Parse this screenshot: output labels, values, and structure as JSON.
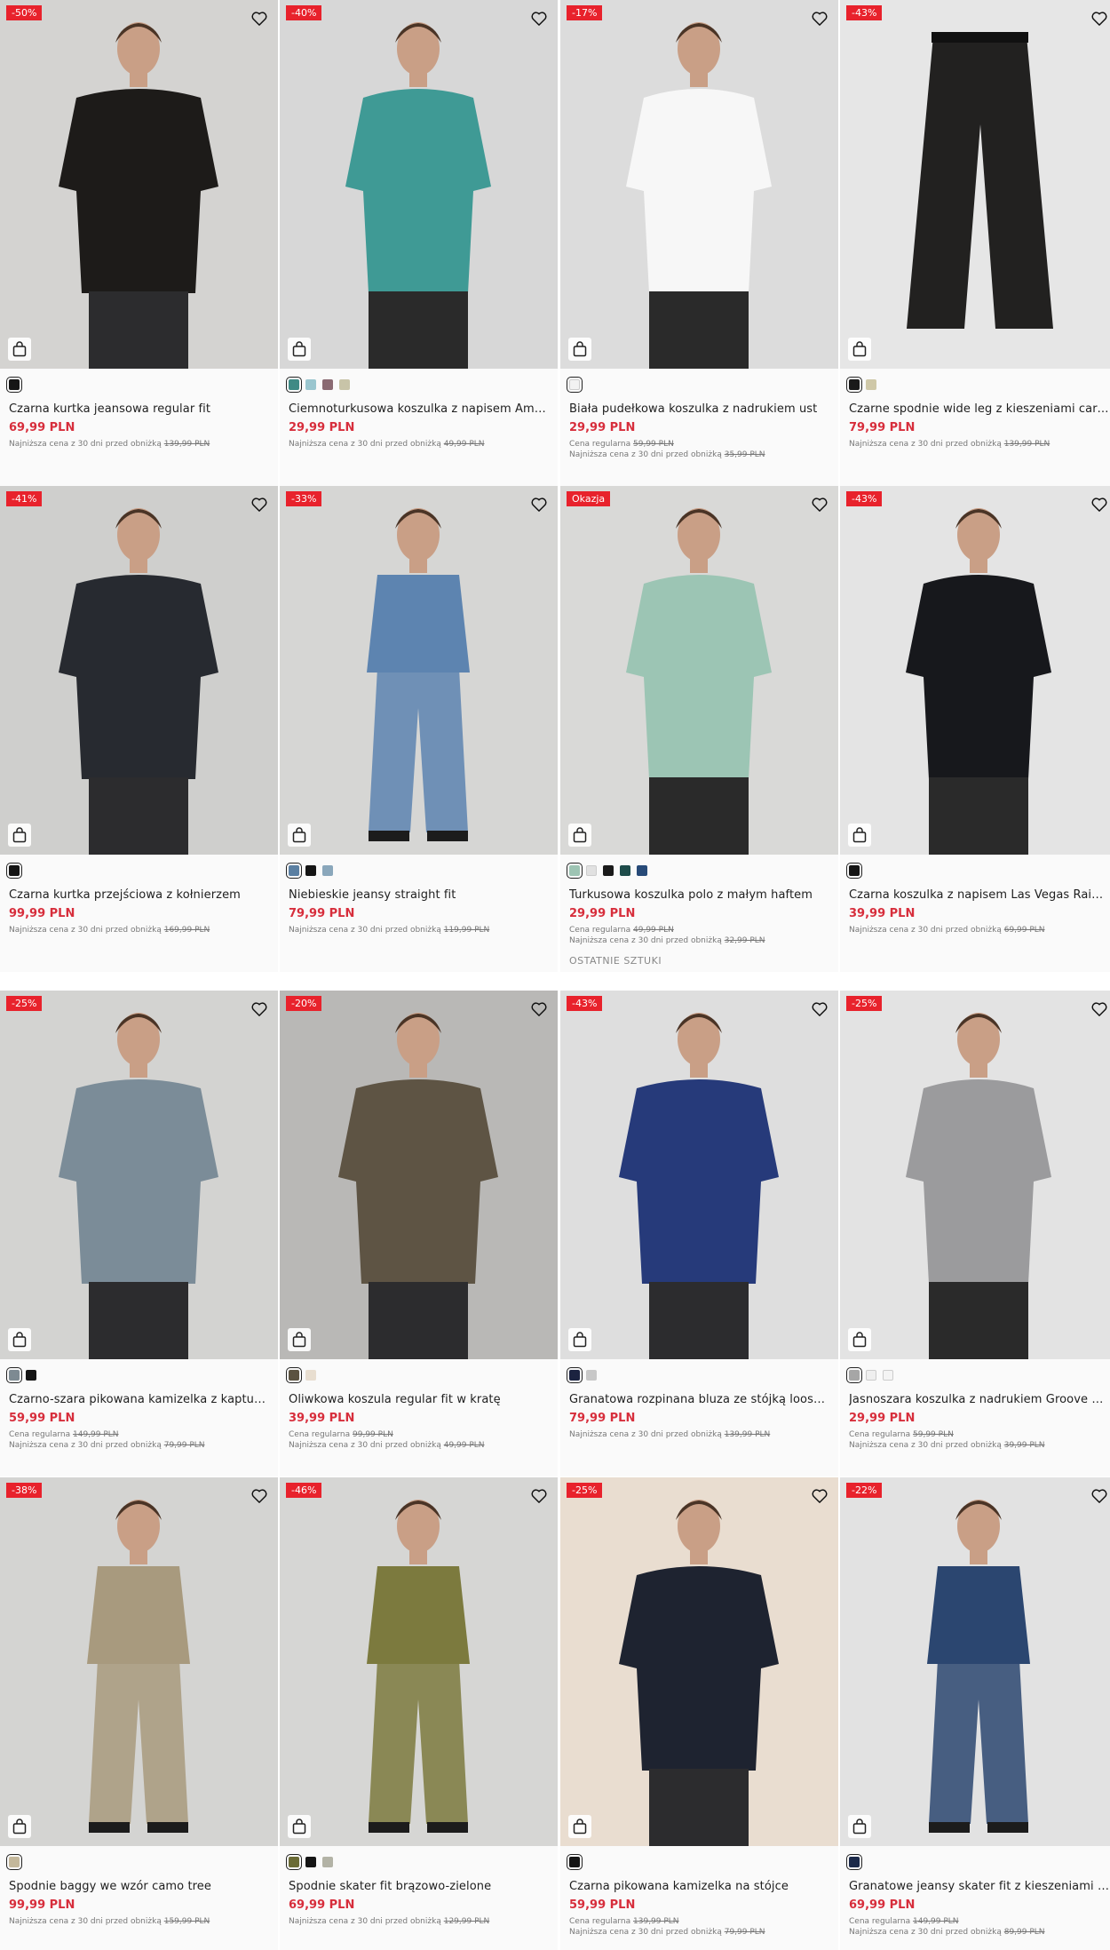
{
  "colors": {
    "discount": "#e8222c",
    "price": "#d72e3c"
  },
  "products": [
    {
      "name": "Czarna kurtka jeansowa regular fit",
      "price": "69,99 PLN",
      "badge": "-50%",
      "swatches": [
        "#151515"
      ],
      "regular_label": "",
      "regular_old": "",
      "lowest_label": "Najniższa cena z 30 dni przed obniżką",
      "lowest_old": "139,99 PLN",
      "extra": "",
      "bg": "#d4d3d1",
      "garment": "#1d1b19",
      "kind": "jacket"
    },
    {
      "name": "Ciemnoturkusowa koszulka z napisem Amalfi Coast",
      "price": "29,99 PLN",
      "badge": "-40%",
      "swatches": [
        "#3f8a85",
        "#9ac6cf",
        "#8a6a72",
        "#c8c4a8"
      ],
      "regular_label": "",
      "regular_old": "",
      "lowest_label": "Najniższa cena z 30 dni przed obniżką",
      "lowest_old": "49,99 PLN",
      "extra": "",
      "bg": "#d7d7d7",
      "garment": "#3f9a95",
      "kind": "tee"
    },
    {
      "name": "Biała pudełkowa koszulka z nadrukiem ust",
      "price": "29,99 PLN",
      "badge": "-17%",
      "swatches": [
        "#f2f2f2"
      ],
      "regular_label": "Cena regularna",
      "regular_old": "59,99 PLN",
      "lowest_label": "Najniższa cena z 30 dni przed obniżką",
      "lowest_old": "35,99 PLN",
      "extra": "",
      "bg": "#dcdcdc",
      "garment": "#f7f7f7",
      "kind": "tee"
    },
    {
      "name": "Czarne spodnie wide leg z kieszeniami cargo",
      "price": "79,99 PLN",
      "badge": "-43%",
      "swatches": [
        "#1a1a1a",
        "#cfc8a8"
      ],
      "regular_label": "",
      "regular_old": "",
      "lowest_label": "Najniższa cena z 30 dni przed obniżką",
      "lowest_old": "139,99 PLN",
      "extra": "",
      "bg": "#e6e6e6",
      "garment": "#222120",
      "kind": "pants"
    },
    {
      "name": "Czarna kurtka przejściowa z kołnierzem",
      "price": "99,99 PLN",
      "badge": "-41%",
      "swatches": [
        "#151515"
      ],
      "regular_label": "",
      "regular_old": "",
      "lowest_label": "Najniższa cena z 30 dni przed obniżką",
      "lowest_old": "169,99 PLN",
      "extra": "",
      "bg": "#cfcfcd",
      "garment": "#272a30",
      "kind": "jacket"
    },
    {
      "name": "Niebieskie jeansy straight fit",
      "price": "79,99 PLN",
      "badge": "-33%",
      "swatches": [
        "#5a7fa2",
        "#151515",
        "#8aa7bb"
      ],
      "regular_label": "",
      "regular_old": "",
      "lowest_label": "Najniższa cena z 30 dni przed obniżką",
      "lowest_old": "119,99 PLN",
      "extra": "",
      "bg": "#d6d6d4",
      "garment": "#5d84b0",
      "kind": "full"
    },
    {
      "name": "Turkusowa koszulka polo z małym haftem",
      "price": "29,99 PLN",
      "badge": "Okazja",
      "swatches": [
        "#9dc4b3",
        "#e1e1e1",
        "#1a1a1a",
        "#1e4c4a",
        "#274a78"
      ],
      "regular_label": "Cena regularna",
      "regular_old": "49,99 PLN",
      "lowest_label": "Najniższa cena z 30 dni przed obniżką",
      "lowest_old": "32,99 PLN",
      "extra": "OSTATNIE SZTUKI",
      "bg": "#d9d9d7",
      "garment": "#9cc5b4",
      "kind": "tee"
    },
    {
      "name": "Czarna koszulka z napisem Las Vegas Raiders",
      "price": "39,99 PLN",
      "badge": "-43%",
      "swatches": [
        "#151515"
      ],
      "regular_label": "",
      "regular_old": "",
      "lowest_label": "Najniższa cena z 30 dni przed obniżką",
      "lowest_old": "69,99 PLN",
      "extra": "",
      "bg": "#e4e4e4",
      "garment": "#17181c",
      "kind": "tee"
    },
    {
      "name": "Czarno-szara pikowana kamizelka z kapturem",
      "price": "59,99 PLN",
      "badge": "-25%",
      "swatches": [
        "#7d8a92",
        "#151515"
      ],
      "regular_label": "Cena regularna",
      "regular_old": "149,99 PLN",
      "lowest_label": "Najniższa cena z 30 dni przed obniżką",
      "lowest_old": "79,99 PLN",
      "extra": "",
      "bg": "#d3d3d1",
      "garment": "#7b8c98",
      "kind": "jacket"
    },
    {
      "name": "Oliwkowa koszula regular fit w kratę",
      "price": "39,99 PLN",
      "badge": "-20%",
      "swatches": [
        "#5b5240",
        "#e8ded0"
      ],
      "regular_label": "Cena regularna",
      "regular_old": "99,99 PLN",
      "lowest_label": "Najniższa cena z 30 dni przed obniżką",
      "lowest_old": "49,99 PLN",
      "extra": "",
      "bg": "#b9b8b6",
      "garment": "#5e5444",
      "kind": "jacket"
    },
    {
      "name": "Granatowa rozpinana bluza ze stójką loose fit",
      "price": "79,99 PLN",
      "badge": "-43%",
      "swatches": [
        "#1b2340",
        "#c8c8c8"
      ],
      "regular_label": "",
      "regular_old": "",
      "lowest_label": "Najniższa cena z 30 dni przed obniżką",
      "lowest_old": "139,99 PLN",
      "extra": "",
      "bg": "#dedede",
      "garment": "#263a7a",
      "kind": "jacket"
    },
    {
      "name": "Jasnoszara koszulka z nadrukiem Groove Hotel",
      "price": "29,99 PLN",
      "badge": "-25%",
      "swatches": [
        "#a6a6a6",
        "#efefef",
        "#f4f4f4"
      ],
      "regular_label": "Cena regularna",
      "regular_old": "59,99 PLN",
      "lowest_label": "Najniższa cena z 30 dni przed obniżką",
      "lowest_old": "39,99 PLN",
      "extra": "",
      "bg": "#e3e3e3",
      "garment": "#9b9b9d",
      "kind": "tee"
    },
    {
      "name": "Spodnie baggy we wzór camo tree",
      "price": "99,99 PLN",
      "badge": "-38%",
      "swatches": [
        "#c4b89b"
      ],
      "regular_label": "",
      "regular_old": "",
      "lowest_label": "Najniższa cena z 30 dni przed obniżką",
      "lowest_old": "159,99 PLN",
      "extra": "",
      "bg": "#d4d4d2",
      "garment": "#a89a7e",
      "kind": "full"
    },
    {
      "name": "Spodnie skater fit brązowo-zielone",
      "price": "69,99 PLN",
      "badge": "-46%",
      "swatches": [
        "#6a6b35",
        "#151515",
        "#b3b3a6"
      ],
      "regular_label": "",
      "regular_old": "",
      "lowest_label": "Najniższa cena z 30 dni przed obniżką",
      "lowest_old": "129,99 PLN",
      "extra": "",
      "bg": "#d6d6d4",
      "garment": "#7c7a3e",
      "kind": "full"
    },
    {
      "name": "Czarna pikowana kamizelka na stójce",
      "price": "59,99 PLN",
      "badge": "-25%",
      "swatches": [
        "#151515"
      ],
      "regular_label": "Cena regularna",
      "regular_old": "139,99 PLN",
      "lowest_label": "Najniższa cena z 30 dni przed obniżką",
      "lowest_old": "79,99 PLN",
      "extra": "",
      "bg": "#e9ddd0",
      "garment": "#1e2330",
      "kind": "jacket"
    },
    {
      "name": "Granatowe jeansy skater fit z kieszeniami cargo",
      "price": "69,99 PLN",
      "badge": "-22%",
      "swatches": [
        "#1c2a4a"
      ],
      "regular_label": "Cena regularna",
      "regular_old": "149,99 PLN",
      "lowest_label": "Najniższa cena z 30 dni przed obniżką",
      "lowest_old": "89,99 PLN",
      "extra": "",
      "bg": "#e2e2e2",
      "garment": "#2b4670",
      "kind": "full"
    }
  ]
}
